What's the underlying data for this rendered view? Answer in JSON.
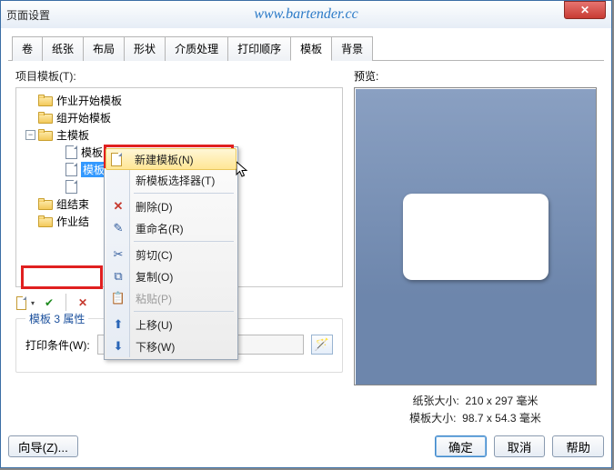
{
  "titlebar": {
    "title": "页面设置",
    "url": "www.bartender.cc"
  },
  "tabs": [
    "卷",
    "纸张",
    "布局",
    "形状",
    "介质处理",
    "打印顺序",
    "模板",
    "背景"
  ],
  "active_tab_index": 6,
  "left": {
    "tree_label": "项目模板(T):",
    "nodes": {
      "n0": "作业开始模板",
      "n1": "组开始模板",
      "n2": "主模板",
      "n2_0": "模板 2",
      "n2_1": "模板",
      "n3": "组结束",
      "n4": "作业结"
    },
    "prop_title": "模板 3 属性",
    "cond_label": "打印条件(W):"
  },
  "context_menu": {
    "items": [
      {
        "key": "new",
        "label": "新建模板(N)",
        "icon": "newdoc"
      },
      {
        "key": "picker",
        "label": "新模板选择器(T)",
        "icon": ""
      },
      {
        "sep": true
      },
      {
        "key": "delete",
        "label": "删除(D)",
        "icon": "del"
      },
      {
        "key": "rename",
        "label": "重命名(R)",
        "icon": "ren"
      },
      {
        "sep": true
      },
      {
        "key": "cut",
        "label": "剪切(C)",
        "icon": "cut"
      },
      {
        "key": "copy",
        "label": "复制(O)",
        "icon": "copy"
      },
      {
        "key": "paste",
        "label": "粘贴(P)",
        "icon": "paste",
        "disabled": true
      },
      {
        "sep": true
      },
      {
        "key": "moveup",
        "label": "上移(U)",
        "icon": "up"
      },
      {
        "key": "movedn",
        "label": "下移(W)",
        "icon": "down"
      }
    ]
  },
  "right": {
    "preview_label": "预览:",
    "paper_label": "纸张大小:",
    "paper_value": "210 x 297 毫米",
    "template_label": "模板大小:",
    "template_value": "98.7 x 54.3 毫米"
  },
  "buttons": {
    "wizard": "向导(Z)...",
    "ok": "确定",
    "cancel": "取消",
    "help": "帮助"
  }
}
